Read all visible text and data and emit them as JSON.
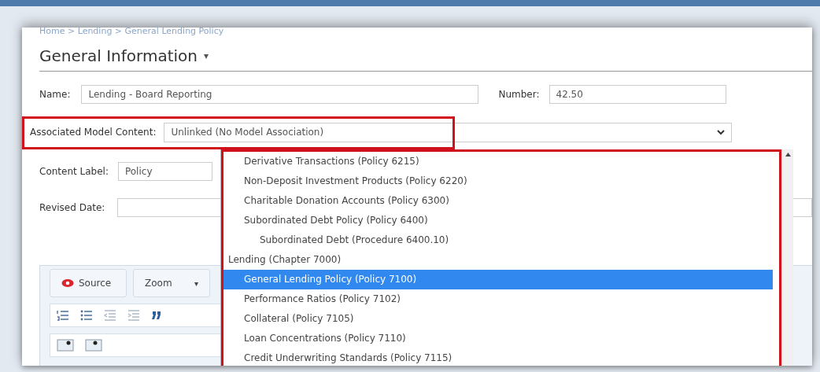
{
  "breadcrumb": "Home > Lending > General Lending Policy",
  "title": "General Information",
  "title_caret": "▾",
  "fields": {
    "name_label": "Name:",
    "name_value": "Lending - Board Reporting",
    "number_label": "Number:",
    "number_value": "42.50",
    "model_label": "Associated Model Content:",
    "model_value": "Unlinked (No Model Association)",
    "content_label": "Content Label:",
    "content_value": "Policy",
    "revised_label": "Revised Date:"
  },
  "dropdown": {
    "options": [
      {
        "kind": "group",
        "children": [
          {
            "kind": "option",
            "label": "Derivative Transactions (Policy 6215)",
            "selected": false
          },
          {
            "kind": "option",
            "label": "Non-Deposit Investment Products (Policy 6220)",
            "selected": false
          },
          {
            "kind": "option",
            "label": "Charitable Donation Accounts (Policy 6300)",
            "selected": false
          },
          {
            "kind": "option",
            "label": "Subordinated Debt Policy (Policy 6400)",
            "selected": false,
            "children": [
              {
                "kind": "option",
                "label": "Subordinated Debt (Procedure 6400.10)",
                "selected": false
              }
            ]
          }
        ]
      },
      {
        "kind": "option",
        "label": "Lending (Chapter 7000)",
        "selected": false,
        "children": [
          {
            "kind": "option",
            "label": "General Lending Policy (Policy 7100)",
            "selected": true
          },
          {
            "kind": "option",
            "label": "Performance Ratios (Policy 7102)",
            "selected": false
          },
          {
            "kind": "option",
            "label": "Collateral (Policy 7105)",
            "selected": false
          },
          {
            "kind": "option",
            "label": "Loan Concentrations (Policy 7110)",
            "selected": false
          },
          {
            "kind": "option",
            "label": "Credit Underwriting Standards (Policy 7115)",
            "selected": false
          }
        ]
      }
    ]
  },
  "editor": {
    "source_button": "Source",
    "zoom_button": "Zoom",
    "zoom_caret": "▾"
  }
}
